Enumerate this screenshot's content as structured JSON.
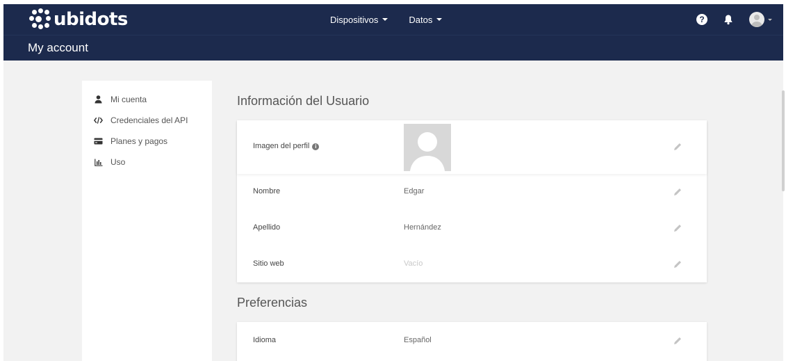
{
  "brand": {
    "name": "ubidots"
  },
  "nav": {
    "items": [
      {
        "label": "Dispositivos"
      },
      {
        "label": "Datos"
      }
    ]
  },
  "header": {
    "title": "My account"
  },
  "sidebar": {
    "items": [
      {
        "label": "Mi cuenta",
        "icon": "user-icon"
      },
      {
        "label": "Credenciales del API",
        "icon": "code-icon"
      },
      {
        "label": "Planes y pagos",
        "icon": "credit-card-icon"
      },
      {
        "label": "Uso",
        "icon": "bar-chart-icon"
      }
    ]
  },
  "user_info": {
    "title": "Información del Usuario",
    "profile_image_label": "Imagen del perfil",
    "rows": [
      {
        "label": "Nombre",
        "value": "Edgar"
      },
      {
        "label": "Apellido",
        "value": "Hernández"
      },
      {
        "label": "Sitio web",
        "value": "Vacío"
      }
    ]
  },
  "preferences": {
    "title": "Preferencias",
    "rows": [
      {
        "label": "Idioma",
        "value": "Español"
      }
    ]
  },
  "colors": {
    "navbar": "#1c2a4d",
    "background": "#f2f2f2",
    "card": "#ffffff"
  }
}
